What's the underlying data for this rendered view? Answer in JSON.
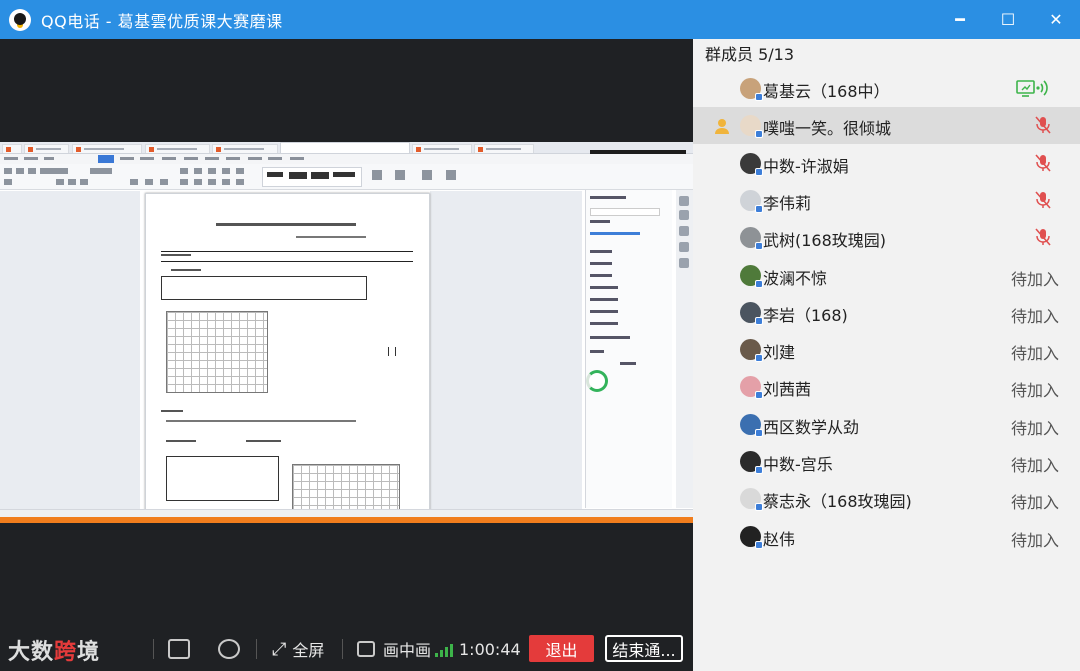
{
  "window": {
    "title": "QQ电话 - 葛基雲优质课大赛磨课",
    "minimize_label": "━",
    "maximize_label": "☐",
    "close_label": "✕"
  },
  "members_panel": {
    "header": "群成员 5/13",
    "members": [
      {
        "name": "葛基云（168中）",
        "status": "speaking",
        "status_text": "",
        "avatar_color": "#c8a27a"
      },
      {
        "name": "噗嗤一笑。很倾城",
        "status": "muted",
        "status_text": "",
        "avatar_color": "#e8d9c8",
        "selected": true
      },
      {
        "name": "中数-许淑娟",
        "status": "muted",
        "status_text": "",
        "avatar_color": "#3a3a3a"
      },
      {
        "name": "李伟莉",
        "status": "muted",
        "status_text": "",
        "avatar_color": "#cfd3d8"
      },
      {
        "name": "武树(168玫瑰园)",
        "status": "muted",
        "status_text": "",
        "avatar_color": "#8e9296"
      },
      {
        "name": "波澜不惊",
        "status": "waiting",
        "status_text": "待加入",
        "avatar_color": "#4f7a3a"
      },
      {
        "name": "李岩（168)",
        "status": "waiting",
        "status_text": "待加入",
        "avatar_color": "#4b5560"
      },
      {
        "name": "刘建",
        "status": "waiting",
        "status_text": "待加入",
        "avatar_color": "#6a5a4a"
      },
      {
        "name": "刘茜茜",
        "status": "waiting",
        "status_text": "待加入",
        "avatar_color": "#e4a0a8"
      },
      {
        "name": "西区数学从劲",
        "status": "waiting",
        "status_text": "待加入",
        "avatar_color": "#3b6fb0"
      },
      {
        "name": "中数-宫乐",
        "status": "waiting",
        "status_text": "待加入",
        "avatar_color": "#2b2b2b"
      },
      {
        "name": "蔡志永（168玫瑰园)",
        "status": "waiting",
        "status_text": "待加入",
        "avatar_color": "#d9d9d9"
      },
      {
        "name": "赵伟",
        "status": "waiting",
        "status_text": "待加入",
        "avatar_color": "#222"
      }
    ]
  },
  "controls": {
    "fullscreen_label": "全屏",
    "pip_label": "画中画",
    "timer": "1:00:44",
    "exit_label": "退出",
    "end_label": "结束通...",
    "watermark_a": "大数",
    "watermark_b": "跨",
    "watermark_c": "境"
  },
  "colors": {
    "titlebar": "#2b8fe3",
    "exit_button": "#e43b3b",
    "signal": "#3db44a",
    "speaking": "#3db44a",
    "muted": "#e05050"
  }
}
